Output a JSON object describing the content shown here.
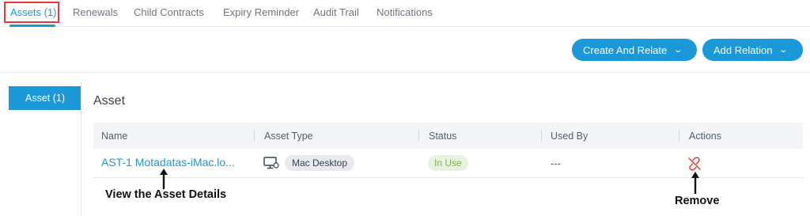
{
  "tabs": [
    {
      "label": "Assets (1)",
      "active": true
    },
    {
      "label": "Renewals"
    },
    {
      "label": "Child Contracts"
    },
    {
      "label": "Expiry Reminder"
    },
    {
      "label": "Audit Trail"
    },
    {
      "label": "Notifications"
    }
  ],
  "toolbar": {
    "create_relate_label": "Create And Relate",
    "add_relation_label": "Add Relation",
    "chevron_icon": "chevron-down-icon"
  },
  "sidebar": {
    "items": [
      {
        "label": "Asset (1)",
        "active": true
      }
    ]
  },
  "section": {
    "title": "Asset"
  },
  "table": {
    "columns": [
      "Name",
      "Asset Type",
      "Status",
      "Used By",
      "Actions"
    ],
    "rows": [
      {
        "name": "AST-1 Motadatas-iMac.lo...",
        "asset_type_icon": "monitor-icon",
        "asset_type": "Mac Desktop",
        "status": "In Use",
        "used_by": "---",
        "action_icon": "unlink-icon"
      }
    ]
  },
  "annotations": {
    "view_details": "View the Asset Details",
    "remove": "Remove"
  },
  "colors": {
    "accent": "#1a98d8",
    "highlight_box": "#e53935",
    "status_green": "#7cb342",
    "remove_red": "#e53935"
  }
}
